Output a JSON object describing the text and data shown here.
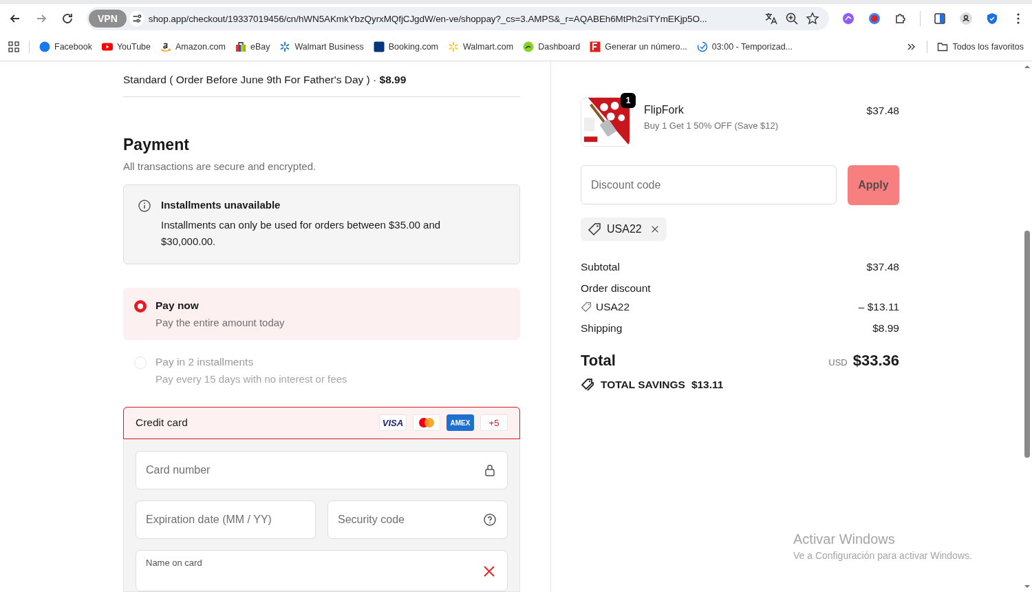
{
  "browser": {
    "vpn": "VPN",
    "url": "shop.app/checkout/19337019456/cn/hWN5AKmkYbzQyrxMQfjCJgdW/en-ve/shoppay?_cs=3.AMPS&_r=AQABEh6MtPh2siTYmEKjp5O...",
    "bookmarks": [
      {
        "label": "Facebook"
      },
      {
        "label": "YouTube"
      },
      {
        "label": "Amazon.com"
      },
      {
        "label": "eBay"
      },
      {
        "label": "Walmart Business"
      },
      {
        "label": "Booking.com"
      },
      {
        "label": "Walmart.com"
      },
      {
        "label": "Dashboard"
      },
      {
        "label": "Generar un número..."
      },
      {
        "label": "03:00 - Temporizad..."
      }
    ],
    "all_bookmarks": "Todos los favoritos"
  },
  "shipping": {
    "method": "Standard ( Order Before June 9th For Father's Day ) · **$8.99**"
  },
  "payment": {
    "title": "Payment",
    "subtitle": "All transactions are secure and encrypted.",
    "notice": {
      "title": "Installments unavailable",
      "text": "Installments can only be used for orders between $35.00 and $30,000.00."
    },
    "options": [
      {
        "title": "Pay now",
        "subtitle": "Pay the entire amount today",
        "selected": true,
        "disabled": false
      },
      {
        "title": "Pay in 2 installments",
        "subtitle": "Pay every 15 days with no interest or fees",
        "selected": false,
        "disabled": true
      }
    ],
    "card": {
      "label": "Credit card",
      "selected": true,
      "brands": [
        {
          "kind": "visa",
          "label": "VISA"
        },
        {
          "kind": "mastercard"
        },
        {
          "kind": "amex",
          "label": "AMEX"
        },
        {
          "kind": "more",
          "label": "+5"
        }
      ],
      "rows": [
        [
          {
            "placeholder": "Card number"
          }
        ],
        [
          {
            "placeholder": "Expiration date (MM / YY)"
          },
          {
            "placeholder": "Security code"
          }
        ]
      ],
      "name_field": {
        "label": "Name on card",
        "invalid": true
      }
    }
  },
  "summary": {
    "item": {
      "name": "FlipFork",
      "quantity": "1",
      "offer": "Buy 1 Get 1 50% OFF (Save $12)",
      "price": "$37.48"
    },
    "discount": {
      "placeholder": "Discount code",
      "button": "Apply"
    },
    "applied_code": "USA22",
    "lines": [
      {
        "kind": "plain",
        "label": "Subtotal",
        "value": "$37.48"
      },
      {
        "kind": "plain",
        "label": "Order discount"
      },
      {
        "kind": "code",
        "label": "USA22",
        "value": "– $13.11"
      },
      {
        "kind": "plain",
        "label": "Shipping",
        "value": "$8.99"
      }
    ],
    "total": {
      "label": "Total",
      "currency": "USD",
      "amount": "$33.36"
    },
    "savings": {
      "label": "TOTAL SAVINGS",
      "amount": "$13.11"
    }
  },
  "os_notice": {
    "title": "Activar Windows",
    "text": "Ve a Configuración para activar Windows."
  }
}
